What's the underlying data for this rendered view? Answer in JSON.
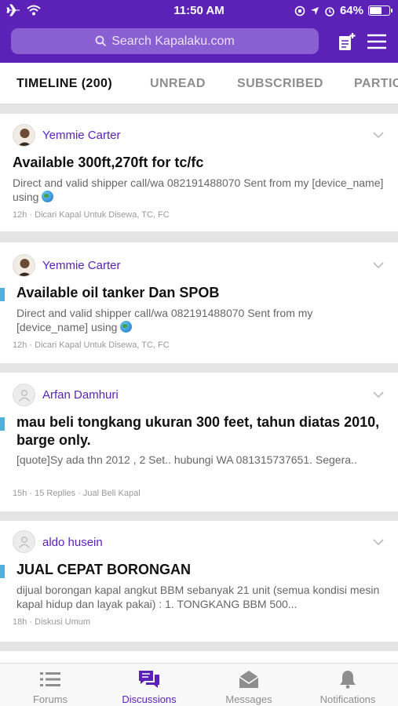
{
  "status_bar": {
    "time": "11:50 AM",
    "battery": "64%",
    "battery_level": 0.64
  },
  "header": {
    "search_placeholder": "Search Kapalaku.com",
    "compose_icon": "new-post-icon",
    "menu_icon": "hamburger-icon"
  },
  "tabs": [
    {
      "label": "TIMELINE (200)",
      "active": true
    },
    {
      "label": "UNREAD",
      "active": false
    },
    {
      "label": "SUBSCRIBED",
      "active": false
    },
    {
      "label": "PARTIC",
      "active": false
    }
  ],
  "threads": [
    {
      "author": "Yemmie Carter",
      "title": "Available 300ft,270ft for tc/fc",
      "snippet": "Direct and valid shipper call/wa 082191488070   Sent from my [device_name] using",
      "time": "12h",
      "forum": "Dicari Kapal Untuk Disewa, TC, FC"
    },
    {
      "author": "Yemmie Carter",
      "title": "Available oil tanker Dan SPOB",
      "snippet": "Direct and valid shipper call/wa 082191488070    Sent from my [device_name] using",
      "time": "12h",
      "forum": "Dicari Kapal Untuk Disewa, TC, FC"
    },
    {
      "author": "Arfan Damhuri",
      "title": "mau beli tongkang ukuran 300 feet, tahun diatas 2010, barge only.",
      "snippet": "[quote]Sy ada thn 2012 , 2 Set.. hubungi WA 081315737651. Segera..",
      "time": "15h",
      "replies": "15 Replies",
      "forum": "Jual Beli Kapal"
    },
    {
      "author": "aldo husein",
      "title": "JUAL CEPAT BORONGAN",
      "snippet": "dijual borongan kapal angkut BBM sebanyak 21 unit (semua kondisi mesin kapal hidup dan layak pakai) : 1. TONGKANG BBM 500...",
      "time": "18h",
      "forum": "Diskusi Umum"
    }
  ],
  "bottom_nav": [
    {
      "label": "Forums",
      "icon": "list-icon"
    },
    {
      "label": "Discussions",
      "icon": "chat-bubbles-icon",
      "active": true
    },
    {
      "label": "Messages",
      "icon": "envelope-icon"
    },
    {
      "label": "Notifications",
      "icon": "bell-icon"
    }
  ],
  "colors": {
    "brand": "#5c22b8",
    "unread_marker": "#4fb0d8"
  }
}
